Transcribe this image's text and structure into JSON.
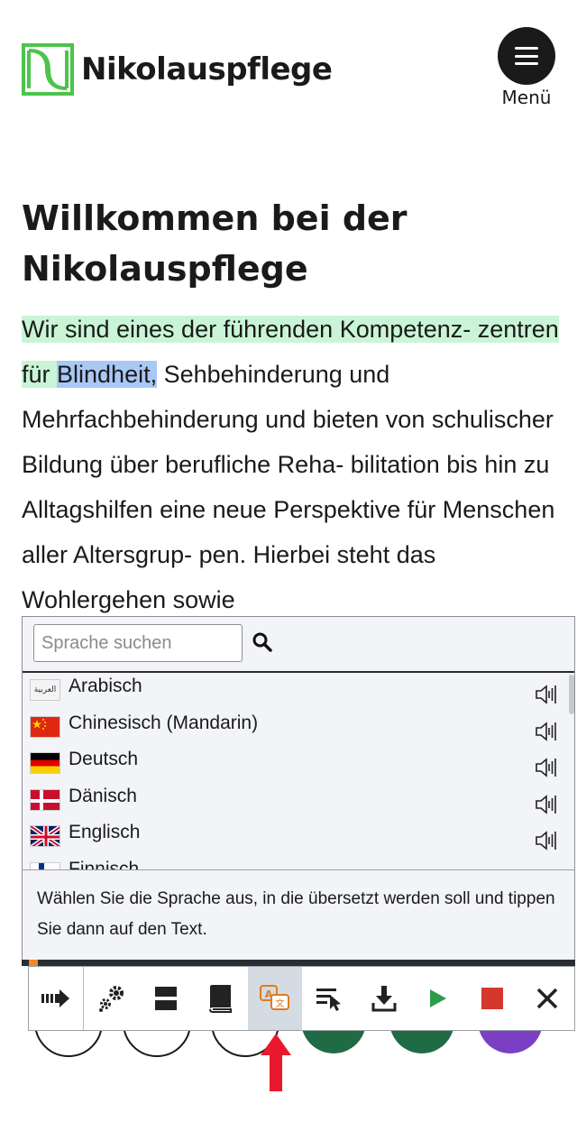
{
  "header": {
    "logo_text": "Nikolauspflege",
    "logo_color": "#4cc44c",
    "menu_label": "Menü"
  },
  "main": {
    "title": "Willkommen bei der Nikolauspflege",
    "intro": {
      "highlight_green": "Wir sind eines der führenden Kompetenz- zentren für ",
      "highlight_blue": "Blindheit,",
      "rest": " Sehbehinderung und Mehrfachbehinderung und bieten von schulischer Bildung über berufliche Reha- bilitation bis hin zu Alltagshilfen eine neue Perspektive für Menschen aller Altersgrup- pen. Hierbei steht das Wohlergehen sowie"
    }
  },
  "language_panel": {
    "search_placeholder": "Sprache suchen",
    "languages": [
      {
        "label": "Arabisch",
        "flag": "arabic-flag-icon",
        "flag_text": "العربية"
      },
      {
        "label": "Chinesisch (Mandarin)",
        "flag": "china-flag-icon"
      },
      {
        "label": "Deutsch",
        "flag": "germany-flag-icon"
      },
      {
        "label": "Dänisch",
        "flag": "denmark-flag-icon"
      },
      {
        "label": "Englisch",
        "flag": "uk-flag-icon"
      },
      {
        "label": "Finnisch",
        "flag": "finland-flag-icon"
      }
    ],
    "hint": "Wählen Sie die Sprache aus, in die übersetzt werden soll und tippen Sie dann auf den Text."
  },
  "toolbar": {
    "buttons": [
      {
        "name": "read-arrow-icon"
      },
      {
        "name": "settings-gears-icon"
      },
      {
        "name": "layout-split-icon"
      },
      {
        "name": "dictionary-book-icon"
      },
      {
        "name": "translate-icon",
        "active": true
      },
      {
        "name": "select-text-icon"
      },
      {
        "name": "download-icon"
      },
      {
        "name": "play-icon",
        "color": "#2e9b4a"
      },
      {
        "name": "stop-icon",
        "color": "#d4372c"
      },
      {
        "name": "close-icon"
      }
    ]
  },
  "colors": {
    "highlight_green": "#c9f5d6",
    "highlight_blue": "#a9c8f5",
    "arrow_red": "#e8192c"
  }
}
